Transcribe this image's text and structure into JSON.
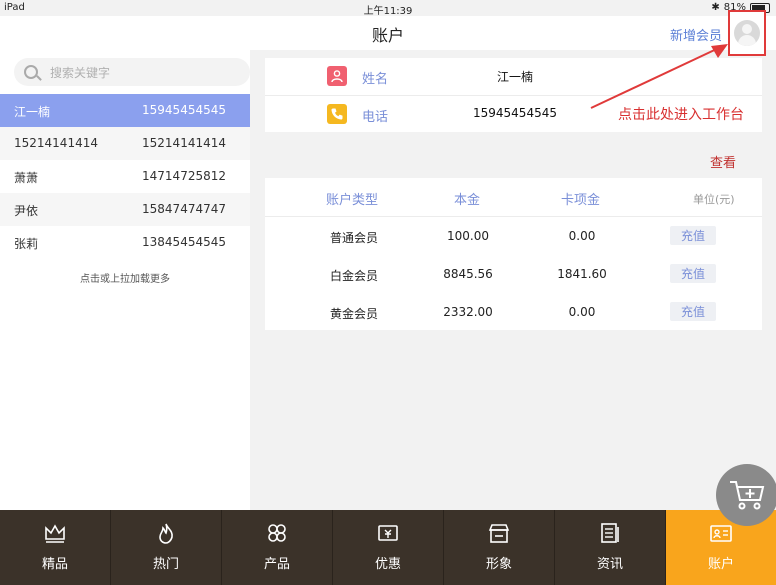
{
  "status_bar": {
    "device": "iPad",
    "time": "上午11:39",
    "battery": "81%"
  },
  "navbar": {
    "title": "账户",
    "add_member": "新增会员"
  },
  "search": {
    "placeholder": "搜索关键字"
  },
  "members": [
    {
      "name": "江一楠",
      "phone": "15945454545",
      "selected": true
    },
    {
      "name": "15214141414",
      "phone": "15214141414",
      "selected": false
    },
    {
      "name": "萧萧",
      "phone": "14714725812",
      "selected": false
    },
    {
      "name": "尹依",
      "phone": "15847474747",
      "selected": false
    },
    {
      "name": "张莉",
      "phone": "13845454545",
      "selected": false
    }
  ],
  "load_more": "点击或上拉加载更多",
  "detail": {
    "name_label": "姓名",
    "name_value": "江一楠",
    "phone_label": "电话",
    "phone_value": "15945454545"
  },
  "annotation": {
    "hint": "点击此处进入工作台"
  },
  "view_link": "查看",
  "account_table": {
    "headers": [
      "账户类型",
      "本金",
      "卡项金",
      "单位(元)"
    ],
    "rows": [
      {
        "type": "普通会员",
        "principal": "100.00",
        "card": "0.00",
        "action": "充值"
      },
      {
        "type": "白金会员",
        "principal": "8845.56",
        "card": "1841.60",
        "action": "充值"
      },
      {
        "type": "黄金会员",
        "principal": "2332.00",
        "card": "0.00",
        "action": "充值"
      }
    ]
  },
  "tabs": [
    {
      "label": "精品",
      "icon": "crown-icon",
      "active": false
    },
    {
      "label": "热门",
      "icon": "flame-icon",
      "active": false
    },
    {
      "label": "产品",
      "icon": "clover-icon",
      "active": false
    },
    {
      "label": "优惠",
      "icon": "ticket-icon",
      "active": false
    },
    {
      "label": "形象",
      "icon": "store-icon",
      "active": false
    },
    {
      "label": "资讯",
      "icon": "news-icon",
      "active": false
    },
    {
      "label": "账户",
      "icon": "id-card-icon",
      "active": true
    }
  ],
  "colors": {
    "accent": "#7a8fd8",
    "selected_row": "#8ba0ee",
    "tabbar": "#3b3229",
    "active_tab": "#f9a51c",
    "annotation": "#d83030"
  }
}
